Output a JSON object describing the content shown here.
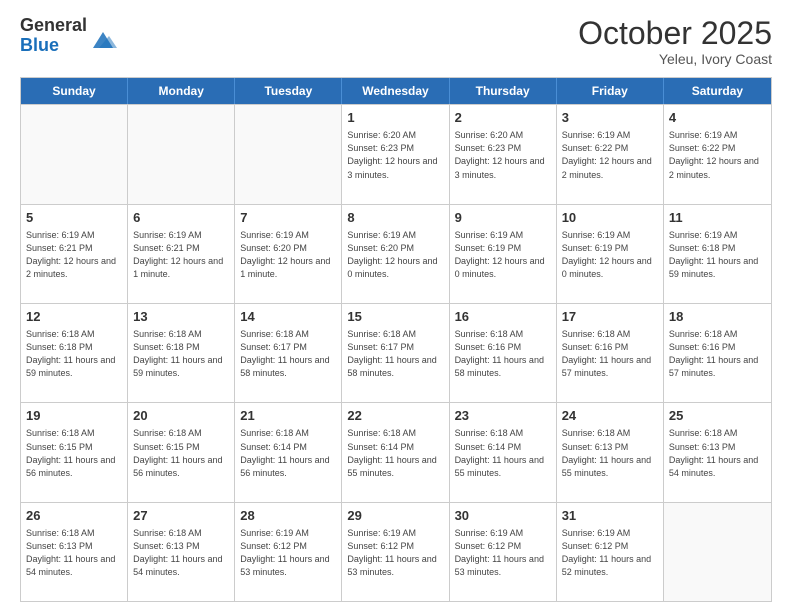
{
  "logo": {
    "general": "General",
    "blue": "Blue"
  },
  "header": {
    "month": "October 2025",
    "location": "Yeleu, Ivory Coast"
  },
  "days_of_week": [
    "Sunday",
    "Monday",
    "Tuesday",
    "Wednesday",
    "Thursday",
    "Friday",
    "Saturday"
  ],
  "weeks": [
    [
      {
        "day": "",
        "info": ""
      },
      {
        "day": "",
        "info": ""
      },
      {
        "day": "",
        "info": ""
      },
      {
        "day": "1",
        "info": "Sunrise: 6:20 AM\nSunset: 6:23 PM\nDaylight: 12 hours and 3 minutes."
      },
      {
        "day": "2",
        "info": "Sunrise: 6:20 AM\nSunset: 6:23 PM\nDaylight: 12 hours and 3 minutes."
      },
      {
        "day": "3",
        "info": "Sunrise: 6:19 AM\nSunset: 6:22 PM\nDaylight: 12 hours and 2 minutes."
      },
      {
        "day": "4",
        "info": "Sunrise: 6:19 AM\nSunset: 6:22 PM\nDaylight: 12 hours and 2 minutes."
      }
    ],
    [
      {
        "day": "5",
        "info": "Sunrise: 6:19 AM\nSunset: 6:21 PM\nDaylight: 12 hours and 2 minutes."
      },
      {
        "day": "6",
        "info": "Sunrise: 6:19 AM\nSunset: 6:21 PM\nDaylight: 12 hours and 1 minute."
      },
      {
        "day": "7",
        "info": "Sunrise: 6:19 AM\nSunset: 6:20 PM\nDaylight: 12 hours and 1 minute."
      },
      {
        "day": "8",
        "info": "Sunrise: 6:19 AM\nSunset: 6:20 PM\nDaylight: 12 hours and 0 minutes."
      },
      {
        "day": "9",
        "info": "Sunrise: 6:19 AM\nSunset: 6:19 PM\nDaylight: 12 hours and 0 minutes."
      },
      {
        "day": "10",
        "info": "Sunrise: 6:19 AM\nSunset: 6:19 PM\nDaylight: 12 hours and 0 minutes."
      },
      {
        "day": "11",
        "info": "Sunrise: 6:19 AM\nSunset: 6:18 PM\nDaylight: 11 hours and 59 minutes."
      }
    ],
    [
      {
        "day": "12",
        "info": "Sunrise: 6:18 AM\nSunset: 6:18 PM\nDaylight: 11 hours and 59 minutes."
      },
      {
        "day": "13",
        "info": "Sunrise: 6:18 AM\nSunset: 6:18 PM\nDaylight: 11 hours and 59 minutes."
      },
      {
        "day": "14",
        "info": "Sunrise: 6:18 AM\nSunset: 6:17 PM\nDaylight: 11 hours and 58 minutes."
      },
      {
        "day": "15",
        "info": "Sunrise: 6:18 AM\nSunset: 6:17 PM\nDaylight: 11 hours and 58 minutes."
      },
      {
        "day": "16",
        "info": "Sunrise: 6:18 AM\nSunset: 6:16 PM\nDaylight: 11 hours and 58 minutes."
      },
      {
        "day": "17",
        "info": "Sunrise: 6:18 AM\nSunset: 6:16 PM\nDaylight: 11 hours and 57 minutes."
      },
      {
        "day": "18",
        "info": "Sunrise: 6:18 AM\nSunset: 6:16 PM\nDaylight: 11 hours and 57 minutes."
      }
    ],
    [
      {
        "day": "19",
        "info": "Sunrise: 6:18 AM\nSunset: 6:15 PM\nDaylight: 11 hours and 56 minutes."
      },
      {
        "day": "20",
        "info": "Sunrise: 6:18 AM\nSunset: 6:15 PM\nDaylight: 11 hours and 56 minutes."
      },
      {
        "day": "21",
        "info": "Sunrise: 6:18 AM\nSunset: 6:14 PM\nDaylight: 11 hours and 56 minutes."
      },
      {
        "day": "22",
        "info": "Sunrise: 6:18 AM\nSunset: 6:14 PM\nDaylight: 11 hours and 55 minutes."
      },
      {
        "day": "23",
        "info": "Sunrise: 6:18 AM\nSunset: 6:14 PM\nDaylight: 11 hours and 55 minutes."
      },
      {
        "day": "24",
        "info": "Sunrise: 6:18 AM\nSunset: 6:13 PM\nDaylight: 11 hours and 55 minutes."
      },
      {
        "day": "25",
        "info": "Sunrise: 6:18 AM\nSunset: 6:13 PM\nDaylight: 11 hours and 54 minutes."
      }
    ],
    [
      {
        "day": "26",
        "info": "Sunrise: 6:18 AM\nSunset: 6:13 PM\nDaylight: 11 hours and 54 minutes."
      },
      {
        "day": "27",
        "info": "Sunrise: 6:18 AM\nSunset: 6:13 PM\nDaylight: 11 hours and 54 minutes."
      },
      {
        "day": "28",
        "info": "Sunrise: 6:19 AM\nSunset: 6:12 PM\nDaylight: 11 hours and 53 minutes."
      },
      {
        "day": "29",
        "info": "Sunrise: 6:19 AM\nSunset: 6:12 PM\nDaylight: 11 hours and 53 minutes."
      },
      {
        "day": "30",
        "info": "Sunrise: 6:19 AM\nSunset: 6:12 PM\nDaylight: 11 hours and 53 minutes."
      },
      {
        "day": "31",
        "info": "Sunrise: 6:19 AM\nSunset: 6:12 PM\nDaylight: 11 hours and 52 minutes."
      },
      {
        "day": "",
        "info": ""
      }
    ]
  ]
}
